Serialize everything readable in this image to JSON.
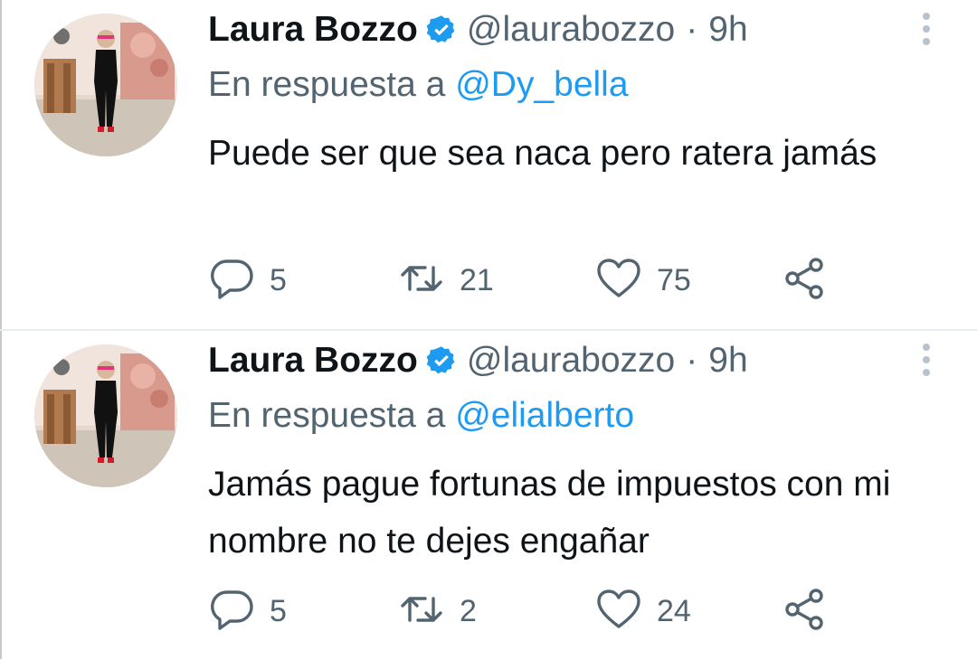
{
  "colors": {
    "accent": "#1d9bf0",
    "text_primary": "#0f1419",
    "text_secondary": "#536471"
  },
  "tweets": [
    {
      "display_name": "Laura Bozzo",
      "verified_icon": "verified-badge-icon",
      "handle": "@laurabozzo",
      "separator": "·",
      "time": "9h",
      "reply_prefix": "En respuesta a",
      "reply_to": "@Dy_bella",
      "text": "Puede ser que sea naca pero ratera jamás",
      "replies": "5",
      "retweets": "21",
      "likes": "75"
    },
    {
      "display_name": "Laura Bozzo",
      "verified_icon": "verified-badge-icon",
      "handle": "@laurabozzo",
      "separator": "·",
      "time": "9h",
      "reply_prefix": "En respuesta a",
      "reply_to": "@elialberto",
      "text": "Jamás pague fortunas de impuestos con mi nombre no te dejes engañar",
      "replies": "5",
      "retweets": "2",
      "likes": "24"
    }
  ]
}
